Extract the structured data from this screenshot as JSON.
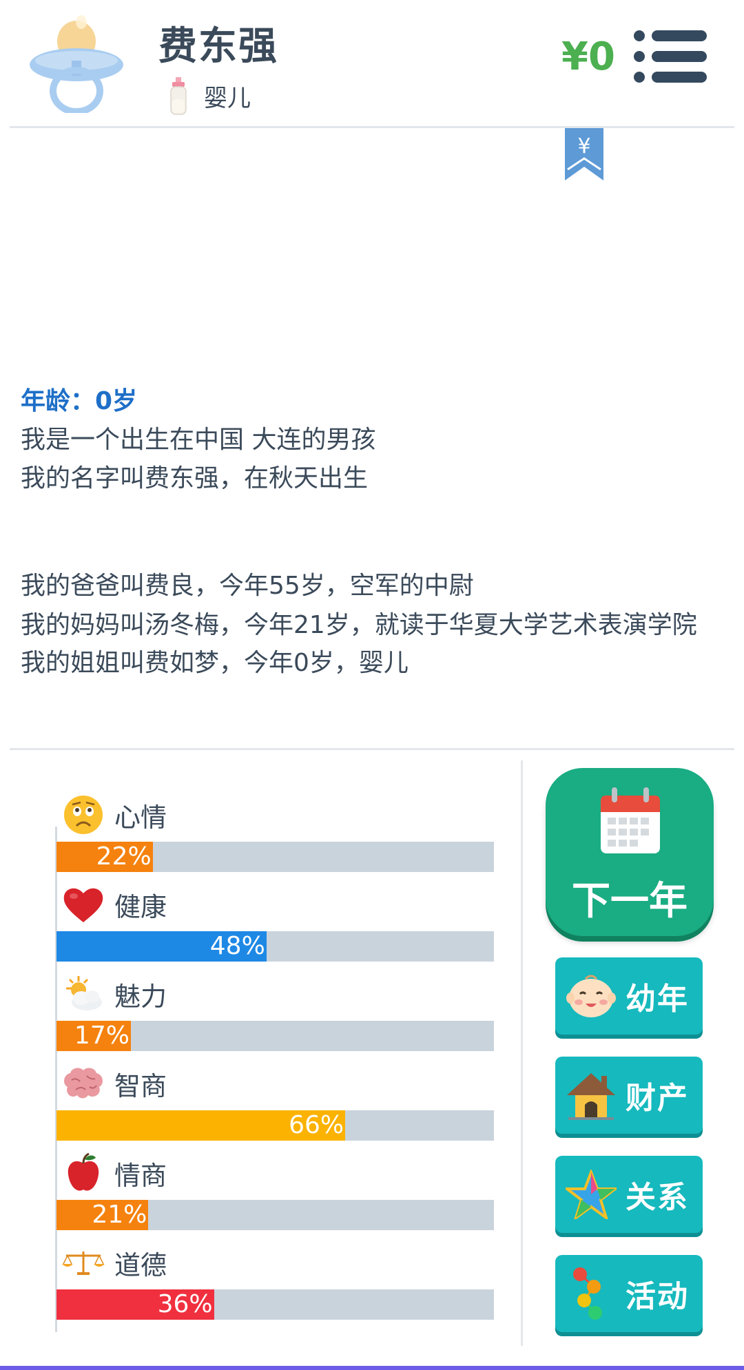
{
  "header": {
    "name": "费东强",
    "stage": "婴儿",
    "money": "¥0",
    "bookmark_symbol": "¥",
    "avatar_icon": "pacifier-icon",
    "stage_icon": "baby-bottle-icon",
    "menu_icon": "menu-list-icon"
  },
  "story": {
    "age": "年龄：0岁",
    "line1": "我是一个出生在中国 大连的男孩",
    "line2": "我的名字叫费东强，在秋天出生",
    "father": "我的爸爸叫费良，今年55岁，空军的中尉",
    "mother": "我的妈妈叫汤冬梅，今年21岁，就读于华夏大学艺术表演学院",
    "sister": "我的姐姐叫费如梦，今年0岁，婴儿"
  },
  "stats": [
    {
      "name": "心情",
      "value": 22,
      "label": "22%",
      "color": "#f5820e",
      "icon": "worried-face-icon"
    },
    {
      "name": "健康",
      "value": 48,
      "label": "48%",
      "color": "#1e88e5",
      "icon": "heart-icon"
    },
    {
      "name": "魅力",
      "value": 17,
      "label": "17%",
      "color": "#f5820e",
      "icon": "sun-cloud-icon"
    },
    {
      "name": "智商",
      "value": 66,
      "label": "66%",
      "color": "#fbb200",
      "icon": "brain-icon"
    },
    {
      "name": "情商",
      "value": 21,
      "label": "21%",
      "color": "#f5820e",
      "icon": "apple-icon"
    },
    {
      "name": "道德",
      "value": 36,
      "label": "36%",
      "color": "#f0303f",
      "icon": "scales-icon"
    }
  ],
  "buttons": {
    "next_year": "下一年",
    "childhood": "幼年",
    "property": "财产",
    "relations": "关系",
    "activities": "活动"
  },
  "colors": {
    "accent_green": "#1aac82",
    "button_teal": "#16b9bd",
    "money_green": "#4caf50",
    "age_blue": "#1e6fc8"
  }
}
